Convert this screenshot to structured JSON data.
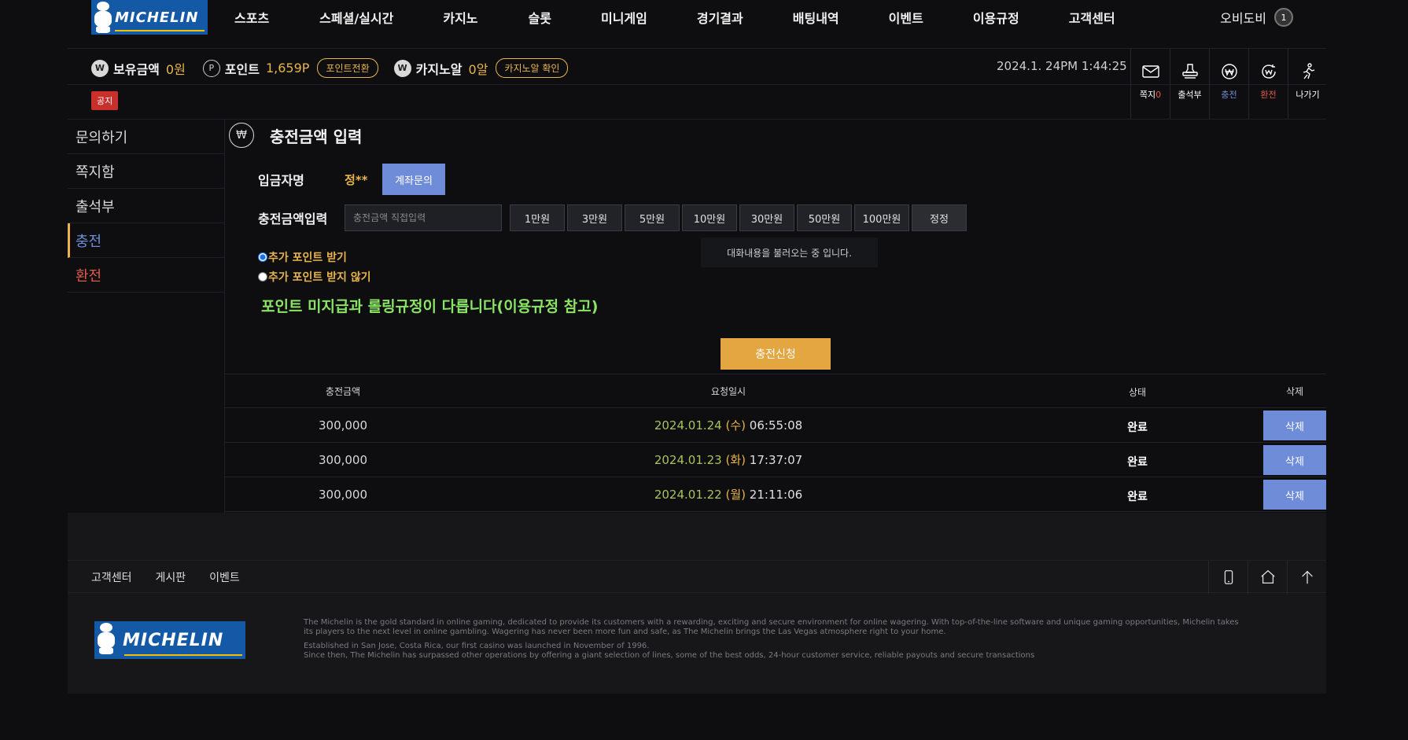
{
  "brand": {
    "logo_text": "MICHELIN",
    "accent": "#e8b44c",
    "blue": "#6f8cd8"
  },
  "nav": {
    "items": [
      "스포츠",
      "스페셜/실시간",
      "카지노",
      "슬롯",
      "미니게임",
      "경기결과",
      "배팅내역",
      "이벤트",
      "이용규정",
      "고객센터"
    ],
    "username": "오비도비",
    "level": "1"
  },
  "wallet": {
    "balance_label": "보유금액",
    "balance_value": "0원",
    "point_label": "포인트",
    "point_value": "1,659P",
    "point_btn": "포인트전환",
    "casino_label": "카지노알",
    "casino_value": "0알",
    "casino_btn": "카지노알 확인"
  },
  "datetime": "2024.1. 24PM 1:44:25",
  "quick": [
    {
      "icon": "mail-icon",
      "label": "쪽지",
      "count": "0"
    },
    {
      "icon": "stamp-icon",
      "label": "출석부"
    },
    {
      "icon": "won-charge-icon",
      "label": "충전"
    },
    {
      "icon": "won-exchange-icon",
      "label": "환전"
    },
    {
      "icon": "run-icon",
      "label": "나가기"
    }
  ],
  "notice_label": "공지",
  "side": [
    "문의하기",
    "쪽지함",
    "출석부",
    "충전",
    "환전"
  ],
  "page": {
    "won_symbol": "₩",
    "title": "충전금액 입력",
    "depositor_label": "입금자명",
    "depositor_name": "정**",
    "account_btn": "계좌문의",
    "amount_label": "충전금액입력",
    "amount_placeholder": "충전금액 직접입력",
    "amount_buttons": [
      "1만원",
      "3만원",
      "5만원",
      "10만원",
      "30만원",
      "50만원",
      "100만원",
      "정정"
    ],
    "tooltip": "대화내용을 불러오는 중 입니다.",
    "radio_yes": "추가 포인트 받기",
    "radio_no": "추가 포인트 받지 않기",
    "warning": "포인트 미지급과 롤링규정이 다릅니다(이용규정 참고)",
    "submit": "충전신청"
  },
  "table": {
    "headers": [
      "충전금액",
      "요청일시",
      "상태",
      "삭제"
    ],
    "rows": [
      {
        "amount": "300,000",
        "date": "2024.01.24",
        "weekday": "(수)",
        "time": "06:55:08",
        "status": "완료",
        "del": "삭제"
      },
      {
        "amount": "300,000",
        "date": "2024.01.23",
        "weekday": "(화)",
        "time": "17:37:07",
        "status": "완료",
        "del": "삭제"
      },
      {
        "amount": "300,000",
        "date": "2024.01.22",
        "weekday": "(월)",
        "time": "21:11:06",
        "status": "완료",
        "del": "삭제"
      }
    ]
  },
  "footer": {
    "links": [
      "고객센터",
      "게시판",
      "이벤트"
    ],
    "text1": "The Michelin is the gold standard in online gaming, dedicated to provide its customers with a rewarding, exciting and secure environment for online wagering. With top-of-the-line software and unique gaming opportunities, Michelin takes its players to the next level in online gambling. Wagering has never been more fun and safe, as The Michelin brings the Las Vegas atmosphere right to your home.",
    "text2": "Established in San Jose, Costa Rica, our first casino was launched in November of 1996.",
    "text3": "Since then, The Michelin has surpassed other operations by offering a giant selection of lines, some of the best odds, 24-hour customer service, reliable payouts and secure transactions"
  }
}
